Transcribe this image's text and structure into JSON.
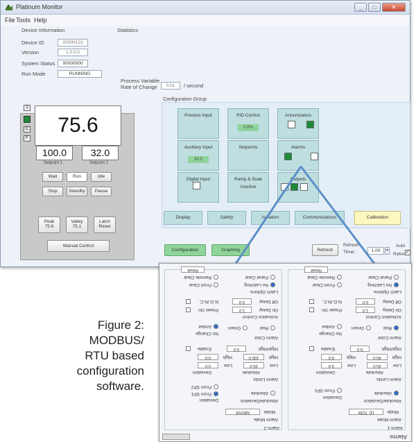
{
  "window": {
    "title": "Platinum Monitor"
  },
  "menu": [
    "File",
    "Tools",
    "Help"
  ],
  "device_info": {
    "heading": "Device Information",
    "id_label": "Device ID",
    "id_value": "00000123",
    "version_label": "Version",
    "version_value": "1.0.0.0",
    "status_label": "System Status",
    "status_value": "00000000",
    "run_label": "Run Mode",
    "run_value": "RUNNING"
  },
  "statistics": {
    "heading": "Statistics"
  },
  "pv_rate": {
    "label_line1": "Process Variable",
    "label_line2": "Rate of Change",
    "value": "0.01",
    "unit": "/ second"
  },
  "panel": {
    "side_buttons": [
      "1",
      "",
      "C",
      "F"
    ],
    "pv": "75.6",
    "sp1": "100.0",
    "sp2": "32.0",
    "sp1_label": "Setpoint 1",
    "sp2_label": "Setpoint 2",
    "row1": [
      "Wait",
      "Run",
      "Idle"
    ],
    "row2": [
      "Stop",
      "Standby",
      "Pause"
    ],
    "peak_label": "Peak",
    "peak_value": "75.6",
    "valley_label": "Valley",
    "valley_value": "75.1",
    "latch_label": "Latch",
    "latch_value": "Reset",
    "manual": "Manual Control"
  },
  "config_group": {
    "heading": "Configuration Group",
    "tiles": [
      {
        "label": "Process Input",
        "extra": ""
      },
      {
        "label": "PID Control",
        "extra": "0.0%"
      },
      {
        "label": "Annunciators",
        "extra": ""
      },
      {
        "label": "Auxiliary Input",
        "extra": "32.5"
      },
      {
        "label": "Setpoints",
        "extra": ""
      },
      {
        "label": "Alarms",
        "extra": ""
      },
      {
        "label": "Digital Input",
        "extra": ""
      },
      {
        "label": "Ramp & Soak",
        "label2": "Inactive",
        "extra": ""
      },
      {
        "label": "Outputs",
        "extra": ""
      }
    ],
    "tabs": [
      "Display",
      "Safety",
      "Isolation",
      "Communications",
      "Calibration"
    ]
  },
  "bottom": {
    "configuration": "Configuration",
    "graphing": "Graphing",
    "refresh": "Refresh",
    "timer_label1": "Refresh",
    "timer_label2": "Timer",
    "timer_value": "1.00",
    "auto_label1": "Auto",
    "auto_label2": "Refresh"
  },
  "popup": {
    "title": "Alarms",
    "alarm1": {
      "heading": "Alarm 1",
      "mode_label": "Alarm Mode",
      "mode_label2": "Mode",
      "mode_value": "LE TOW",
      "abs_dev_label": "Absolute/Deviation",
      "absolute": "Absolute",
      "deviation": "Deviation",
      "from_sp1": "From SP1",
      "limits_label": "Alarm Limits",
      "absolute2": "Absolute",
      "deviation2": "Deviation",
      "low": "Low",
      "low_abs": "35.0",
      "low_dev": "0.0",
      "high": "High",
      "high_abs": "40.0",
      "high_dev": "0.0",
      "hilo": "High/High",
      "hilo_val": "0.0",
      "enable": "Enable",
      "color_label": "Alarm Color",
      "color_red": "Red",
      "color_green": "Green",
      "color_amber": "Amber",
      "no_change": "No Change",
      "act_label": "Activation Control",
      "on_delay": "On Delay",
      "on_delay_val": "1.0",
      "off_delay": "Off Delay",
      "off_delay_val": "0.0",
      "power_on": "Power On",
      "nofc": "N.O./N.C.",
      "latch_label": "Latch Options",
      "latching": "No Latching",
      "front_clear": "Front Clear",
      "panel_clear": "Panel Clear",
      "remote_clear": "Remote Clear",
      "reset": "Reset"
    },
    "alarm2": {
      "heading": "Alarm 2",
      "mode_label": "Alarm Mode",
      "mode_label2": "Mode",
      "mode_value": "ABOVE",
      "abs_dev_label": "Absolute/Deviation",
      "absolute": "Absolute",
      "deviation": "Deviation",
      "from_sp1": "From SP1",
      "from_sp2": "From SP2",
      "limits_label": "Alarm Limits",
      "absolute2": "Absolute",
      "deviation2": "Deviation",
      "low": "Low",
      "low_abs": "35.0",
      "low_dev": "0.0",
      "high": "High",
      "high_abs": "100.0",
      "high_dev": "0.0",
      "hilo": "High/High",
      "hilo_val": "0.0",
      "enable": "Enable",
      "color_label": "Alarm Color",
      "color_red": "Red",
      "color_green": "Green",
      "color_amber": "Amber",
      "no_change": "No Change",
      "act_label": "Activation Control",
      "on_delay": "On Delay",
      "on_delay_val": "1.0",
      "off_delay": "Off Delay",
      "off_delay_val": "0.0",
      "power_on": "Power On",
      "nofc": "N.O./N.C.",
      "latch_label": "Latch Options",
      "latching": "No Latching",
      "front_clear": "Front Clear",
      "panel_clear": "Panel Clear",
      "remote_clear": "Remote Clear",
      "reset": "Reset"
    }
  },
  "caption": {
    "line1": "Figure 2:",
    "line2": "MODBUS/",
    "line3": "RTU based",
    "line4": "configuration",
    "line5": "software."
  },
  "colors": {
    "tile": "#bedee0",
    "green_button": "#8fd59a",
    "calibration": "#fdf7c0",
    "indicator_on": "#1e8a3a",
    "connector": "#5b8fc7"
  }
}
